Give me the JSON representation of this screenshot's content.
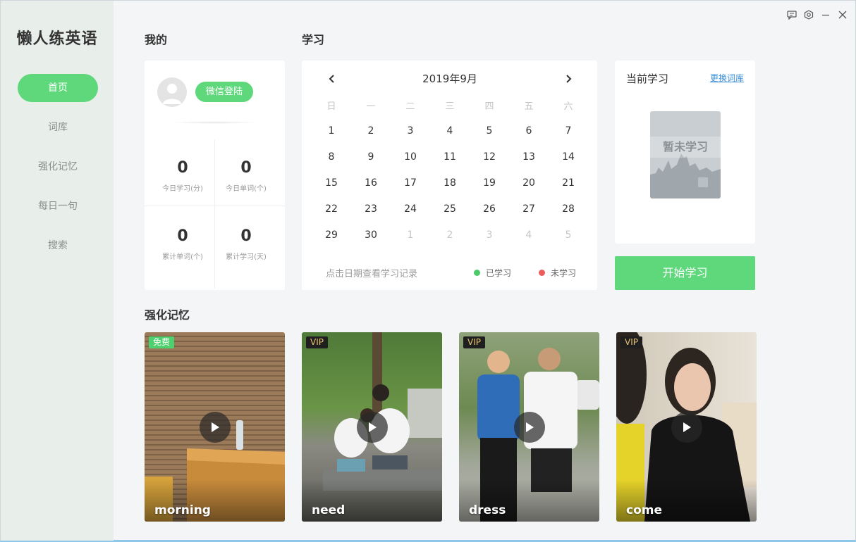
{
  "app": {
    "title": "懒人练英语"
  },
  "sidebar": {
    "items": [
      {
        "label": "首页",
        "active": true
      },
      {
        "label": "词库"
      },
      {
        "label": "强化记忆"
      },
      {
        "label": "每日一句"
      },
      {
        "label": "搜索"
      }
    ]
  },
  "window_controls": [
    "feedback-icon",
    "settings-icon",
    "minimize-icon",
    "close-icon"
  ],
  "profile": {
    "section_title": "我的",
    "login_button": "微信登陆",
    "stats": [
      {
        "value": "0",
        "label": "今日学习(分)"
      },
      {
        "value": "0",
        "label": "今日单词(个)"
      },
      {
        "value": "0",
        "label": "累计单词(个)"
      },
      {
        "value": "0",
        "label": "累计学习(天)"
      }
    ]
  },
  "calendar": {
    "section_title": "学习",
    "month": "2019年9月",
    "weekdays": [
      "日",
      "一",
      "二",
      "三",
      "四",
      "五",
      "六"
    ],
    "weeks": [
      [
        {
          "d": "1"
        },
        {
          "d": "2"
        },
        {
          "d": "3"
        },
        {
          "d": "4"
        },
        {
          "d": "5"
        },
        {
          "d": "6"
        },
        {
          "d": "7"
        }
      ],
      [
        {
          "d": "8"
        },
        {
          "d": "9"
        },
        {
          "d": "10"
        },
        {
          "d": "11"
        },
        {
          "d": "12"
        },
        {
          "d": "13"
        },
        {
          "d": "14"
        }
      ],
      [
        {
          "d": "15"
        },
        {
          "d": "16"
        },
        {
          "d": "17"
        },
        {
          "d": "18"
        },
        {
          "d": "19"
        },
        {
          "d": "20"
        },
        {
          "d": "21"
        }
      ],
      [
        {
          "d": "22"
        },
        {
          "d": "23"
        },
        {
          "d": "24"
        },
        {
          "d": "25"
        },
        {
          "d": "26"
        },
        {
          "d": "27"
        },
        {
          "d": "28"
        }
      ],
      [
        {
          "d": "29"
        },
        {
          "d": "30"
        },
        {
          "d": "1",
          "muted": true
        },
        {
          "d": "2",
          "muted": true
        },
        {
          "d": "3",
          "muted": true
        },
        {
          "d": "4",
          "muted": true
        },
        {
          "d": "5",
          "muted": true
        }
      ]
    ],
    "hint": "点击日期查看学习记录",
    "legend": [
      {
        "label": "已学习",
        "color": "#4cc96a"
      },
      {
        "label": "未学习",
        "color": "#ec5b5b"
      }
    ]
  },
  "current_study": {
    "title": "当前学习",
    "change_link": "更换词库",
    "book_label": "暂未学习",
    "start_button": "开始学习"
  },
  "reinforce": {
    "section_title": "强化记忆",
    "videos": [
      {
        "badge": "免费",
        "badge_type": "free",
        "word": "morning"
      },
      {
        "badge": "VIP",
        "badge_type": "vip",
        "word": "need"
      },
      {
        "badge": "VIP",
        "badge_type": "vip",
        "word": "dress"
      },
      {
        "badge": "VIP",
        "badge_type": "vip",
        "word": "come"
      }
    ]
  }
}
